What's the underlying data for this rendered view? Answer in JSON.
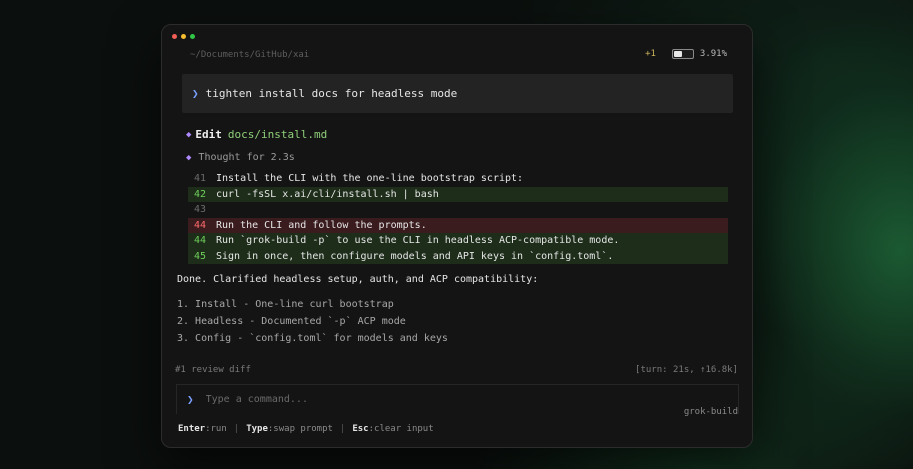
{
  "header": {
    "path": "~/Documents/GitHub/xai",
    "changes": "+1",
    "context_fraction": 0.0391,
    "context_percent": "3.91%"
  },
  "prompt": {
    "text": "tighten install docs for headless mode"
  },
  "edit": {
    "label": "Edit",
    "file": "docs/install.md"
  },
  "thought": {
    "text": "Thought for 2.3s"
  },
  "diff": [
    {
      "line": "41",
      "type": "context",
      "text": "Install the CLI with the one-line bootstrap script:"
    },
    {
      "line": "42",
      "type": "add",
      "text": "curl -fsSL x.ai/cli/install.sh | bash"
    },
    {
      "line": "43",
      "type": "context",
      "text": ""
    },
    {
      "line": "44",
      "type": "del",
      "text": "Run the CLI and follow the prompts."
    },
    {
      "line": "44",
      "type": "add",
      "text": "Run `grok-build -p` to use the CLI in headless ACP-compatible mode."
    },
    {
      "line": "45",
      "type": "add",
      "text": "Sign in once, then configure models and API keys in `config.toml`."
    }
  ],
  "summary": {
    "done": "Done. Clarified headless setup, auth, and ACP compatibility:",
    "items": [
      "1. Install - One-line curl bootstrap",
      "2. Headless - Documented `-p` ACP mode",
      "3. Config - `config.toml` for models and keys"
    ]
  },
  "footer": {
    "left": "#1 review diff",
    "right": "[turn: 21s, ↑16.8k]"
  },
  "input": {
    "placeholder": "Type a command...",
    "agent": "grok-build"
  },
  "hints": [
    {
      "key": "Enter",
      "desc": ":run"
    },
    {
      "key": "Type",
      "desc": ":swap prompt"
    },
    {
      "key": "Esc",
      "desc": ":clear input"
    }
  ],
  "icons": {
    "prompt": "chevron-right-icon",
    "edit": "diamond-icon",
    "thought": "diamond-icon"
  },
  "colors": {
    "accent_blue": "#7aa2ff",
    "accent_purple": "#b08aff",
    "added": "#6fcf5a",
    "removed": "#ff6b6b"
  }
}
